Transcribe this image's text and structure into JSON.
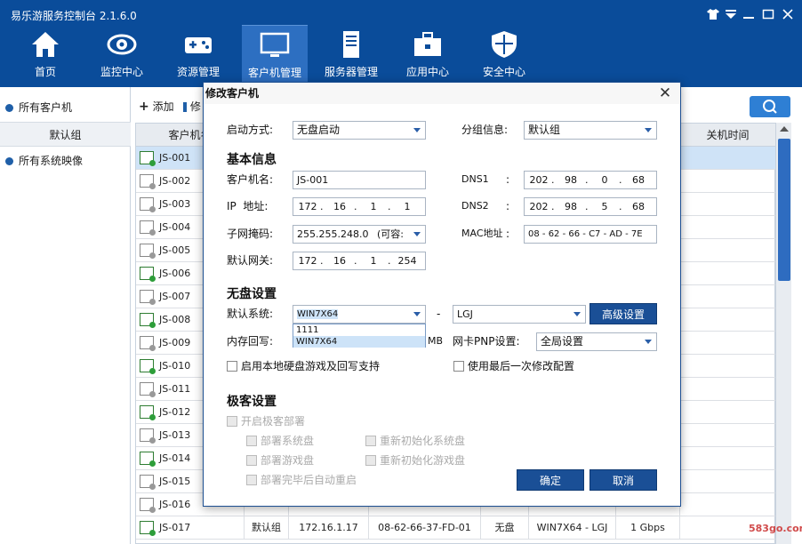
{
  "app": {
    "title": "易乐游服务控制台 2.1.6.0",
    "window_controls": [
      "shirt-icon",
      "menu-icon",
      "minimize-icon",
      "close-icon"
    ]
  },
  "nav": [
    {
      "label": "首页",
      "icon": "home-icon"
    },
    {
      "label": "监控中心",
      "icon": "eye-icon"
    },
    {
      "label": "资源管理",
      "icon": "gamepad-icon"
    },
    {
      "label": "客户机管理",
      "icon": "monitor-icon",
      "active": true
    },
    {
      "label": "服务器管理",
      "icon": "server-icon"
    },
    {
      "label": "应用中心",
      "icon": "toolbox-icon"
    },
    {
      "label": "安全中心",
      "icon": "shield-icon"
    }
  ],
  "sidebar": {
    "items": [
      {
        "label": "所有客户机"
      },
      {
        "label": "默认组",
        "sub": true
      },
      {
        "label": "所有系统映像"
      }
    ]
  },
  "toolbar": {
    "add_label": "添加",
    "edit_label": "修"
  },
  "table": {
    "headers": [
      "客户机名",
      "关机时间"
    ],
    "rows": [
      {
        "name": "JS-001",
        "online": true,
        "selected": true
      },
      {
        "name": "JS-002",
        "online": false
      },
      {
        "name": "JS-003",
        "online": false
      },
      {
        "name": "JS-004",
        "online": false
      },
      {
        "name": "JS-005",
        "online": false
      },
      {
        "name": "JS-006",
        "online": true
      },
      {
        "name": "JS-007",
        "online": false
      },
      {
        "name": "JS-008",
        "online": true
      },
      {
        "name": "JS-009",
        "online": false
      },
      {
        "name": "JS-010",
        "online": true
      },
      {
        "name": "JS-011",
        "online": false
      },
      {
        "name": "JS-012",
        "online": true
      },
      {
        "name": "JS-013",
        "online": false
      },
      {
        "name": "JS-014",
        "online": true
      },
      {
        "name": "JS-015",
        "online": false
      },
      {
        "name": "JS-016",
        "online": false
      },
      {
        "name": "JS-017",
        "online": true,
        "group": "默认组",
        "ip": "172.16.1.17",
        "mac": "08-62-66-37-FD-01",
        "boot": "无盘",
        "system": "WIN7X64 - LGJ",
        "speed": "1 Gbps"
      }
    ]
  },
  "dialog": {
    "title": "修改客户机",
    "boot_mode": {
      "label": "启动方式:",
      "value": "无盘启动"
    },
    "group": {
      "label": "分组信息:",
      "value": "默认组"
    },
    "basic_section": "基本信息",
    "name": {
      "label": "客户机名:",
      "value": "JS-001"
    },
    "ip": {
      "label": "IP  地址:",
      "parts": [
        "172",
        "16",
        "1",
        "1"
      ]
    },
    "subnet": {
      "label": "子网掩码:",
      "value": "255.255.248.0",
      "hint": "(可容:"
    },
    "gateway": {
      "label": "默认网关:",
      "parts": [
        "172",
        "16",
        "1",
        "254"
      ]
    },
    "dns1": {
      "label": "DNS1",
      "parts": [
        "202",
        "98",
        "0",
        "68"
      ]
    },
    "dns2": {
      "label": "DNS2",
      "parts": [
        "202",
        "98",
        "5",
        "68"
      ]
    },
    "mac": {
      "label": "MAC地址",
      "value": "08 - 62 - 66 - C7 - AD - 7E"
    },
    "colon": ":",
    "diskless_section": "无盘设置",
    "default_system": {
      "label": "默认系统:",
      "value": "WIN7X64",
      "options": [
        "1111",
        "WIN7X64"
      ]
    },
    "dash": "-",
    "image": {
      "value": "LGJ"
    },
    "advanced_button": "高级设置",
    "mem_writeback": {
      "label": "内存回写:",
      "unit": "MB"
    },
    "nic_pnp": {
      "label": "网卡PNP设置:",
      "value": "全局设置"
    },
    "local_disk_checkbox": "启用本地硬盘游戏及回写支持",
    "last_config_checkbox": "使用最后一次修改配置",
    "extreme_section": "极客设置",
    "enable_extreme": "开启极客部署",
    "deploy_system": "部署系统盘",
    "reinit_system": "重新初始化系统盘",
    "deploy_game": "部署游戏盘",
    "reinit_game": "重新初始化游戏盘",
    "auto_restart": "部署完毕后自动重启",
    "ok_button": "确定",
    "cancel_button": "取消"
  },
  "watermark": "583go.com",
  "colors": {
    "topbar": "#0a4c9a",
    "accent": "#1a4f96",
    "selected_row": "#cfe3f7"
  }
}
